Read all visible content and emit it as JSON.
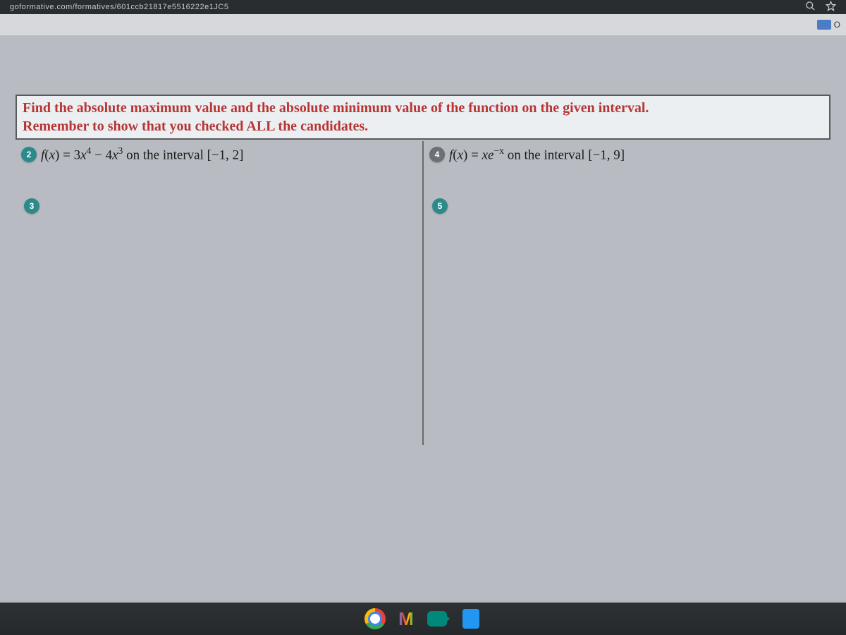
{
  "browser": {
    "url_fragment": "goformative.com/formatives/601ccb21817e5516222e1JC5",
    "toolbar_badge_label": "O"
  },
  "instruction": {
    "line1": "Find the absolute maximum value and the absolute minimum value of the function on the given interval.",
    "line2": "Remember to show that you checked ALL the candidates."
  },
  "problems": {
    "p2": {
      "num": "2",
      "formula_html": "<span>f</span><span class='rm'>(</span><span>x</span><span class='rm'>) = 3</span><span>x</span><span class='sup'>4</span><span class='rm'> − 4</span><span>x</span><span class='sup'>3</span> <span class='rm'>on the interval [−1, 2]</span>"
    },
    "p3": {
      "num": "3"
    },
    "p4": {
      "num": "4",
      "formula_html": "<span>f</span><span class='rm'>(</span><span>x</span><span class='rm'>) = </span><span>xe</span><span class='sup'>−x</span> <span class='rm'>on the interval [−1, 9]</span>"
    },
    "p5": {
      "num": "5"
    }
  },
  "icons": {
    "search": "search-icon",
    "star": "star-icon",
    "folder": "folder-icon",
    "chrome": "chrome-icon",
    "gmail": "gmail-icon",
    "meet": "meet-icon",
    "files": "files-icon"
  }
}
